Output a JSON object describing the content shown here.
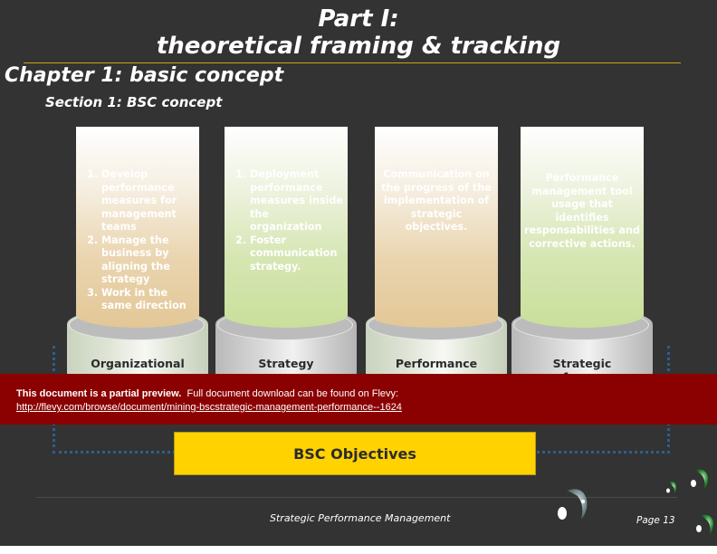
{
  "header": {
    "title_line1": "Part I:",
    "title_line2": "theoretical framing & tracking",
    "chapter": "Chapter 1: basic concept",
    "section": "Section 1: BSC concept"
  },
  "pillars": [
    {
      "label": "Organizational",
      "style": "tan",
      "base": "green",
      "items": [
        "Develop performance measures for management teams",
        "Manage the business by aligning  the strategy",
        "Work in the same direction"
      ]
    },
    {
      "label": "Strategy",
      "style": "green",
      "base": "grey",
      "items": [
        "Deployment performance measures inside the organization",
        "Foster communication strategy."
      ]
    },
    {
      "label": "Performance",
      "style": "tan",
      "base": "green",
      "text": "Communication on the progress of the implementation of strategic objectives."
    },
    {
      "label": "Strategic performance",
      "style": "green",
      "base": "grey",
      "text": "Performance management tool usage that identifies responsabilities and corrective actions."
    }
  ],
  "objectives": {
    "label": "BSC Objectives"
  },
  "banner": {
    "bold_text": "This document is a partial preview.",
    "text": "Full document download can be found on Flevy:",
    "link": "http://flevy.com/browse/document/mining-bscstrategic-management-performance--1624"
  },
  "footer": {
    "title": "Strategic Performance Management",
    "page": "Page 13"
  },
  "colors": {
    "background": "#333333",
    "accent_yellow": "#ffd200",
    "banner_red": "#8b0000",
    "dotted_blue": "#2c5f8e",
    "rule_gold": "#c9a313"
  }
}
